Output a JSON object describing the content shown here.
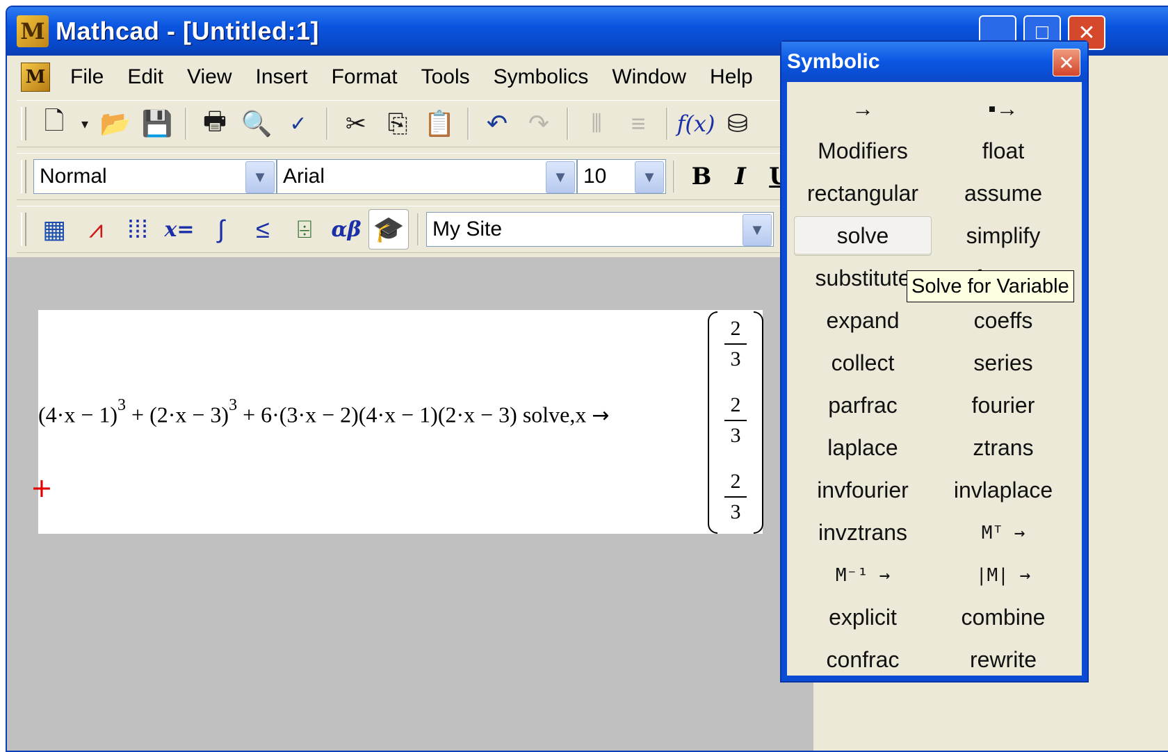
{
  "window": {
    "title": "Mathcad - [Untitled:1]",
    "app_icon": "mathcad-logo",
    "controls": {
      "minimize": "minimize-icon",
      "maximize": "maximize-icon",
      "close": "close-icon"
    }
  },
  "menubar": {
    "items": [
      "File",
      "Edit",
      "View",
      "Insert",
      "Format",
      "Tools",
      "Symbolics",
      "Window",
      "Help"
    ]
  },
  "standard_toolbar": {
    "buttons": [
      "new-document-icon",
      "new-dropdown-icon",
      "open-icon",
      "save-icon",
      "print-icon",
      "print-preview-icon",
      "spell-check-icon",
      "cut-icon",
      "copy-icon",
      "paste-icon",
      "undo-icon",
      "redo-icon",
      "align-across-icon",
      "align-down-icon",
      "insert-function-icon",
      "insert-unit-icon"
    ]
  },
  "formatting_toolbar": {
    "style": "Normal",
    "font": "Arial",
    "size": "10",
    "bold_label": "B",
    "italic_label": "I",
    "underline_label": "U"
  },
  "math_toolbar": {
    "buttons": [
      "calculator-icon",
      "graph-icon",
      "matrix-icon",
      "evaluation-icon",
      "calculus-icon",
      "boolean-icon",
      "programming-icon",
      "greek-icon",
      "resource-center-icon"
    ],
    "eval_label": "x=",
    "greek_label": "αβ",
    "resource_url": "My Site"
  },
  "worksheet": {
    "expression": {
      "part1": "(4·x − 1)",
      "exp1": "3",
      "part2": " + (2·x − 3)",
      "exp2": "3",
      "part3": " + 6·(3·x − 2)(4·x − 1)(2·x − 3)",
      "keyword": " solve,x ",
      "arrow": "→"
    },
    "result": [
      {
        "num": "2",
        "den": "3"
      },
      {
        "num": "2",
        "den": "3"
      },
      {
        "num": "2",
        "den": "3"
      }
    ],
    "cursor_color": "#e00000"
  },
  "palette": {
    "title": "Symbolic",
    "buttons": [
      "→",
      "▪→",
      "Modifiers",
      "float",
      "rectangular",
      "assume",
      "solve",
      "simplify",
      "substitute",
      "factor",
      "expand",
      "coeffs",
      "collect",
      "series",
      "parfrac",
      "fourier",
      "laplace",
      "ztrans",
      "invfourier",
      "invlaplace",
      "invztrans",
      "Mᵀ →",
      "M⁻¹ →",
      "|M| →",
      "explicit",
      "combine",
      "confrac",
      "rewrite"
    ],
    "hovered": "solve",
    "tooltip": "Solve for Variable"
  },
  "colors": {
    "title_blue": "#0a55e0",
    "chrome": "#ece9d8",
    "workspace": "#c0c0c0",
    "tooltip_bg": "#ffffe1"
  }
}
